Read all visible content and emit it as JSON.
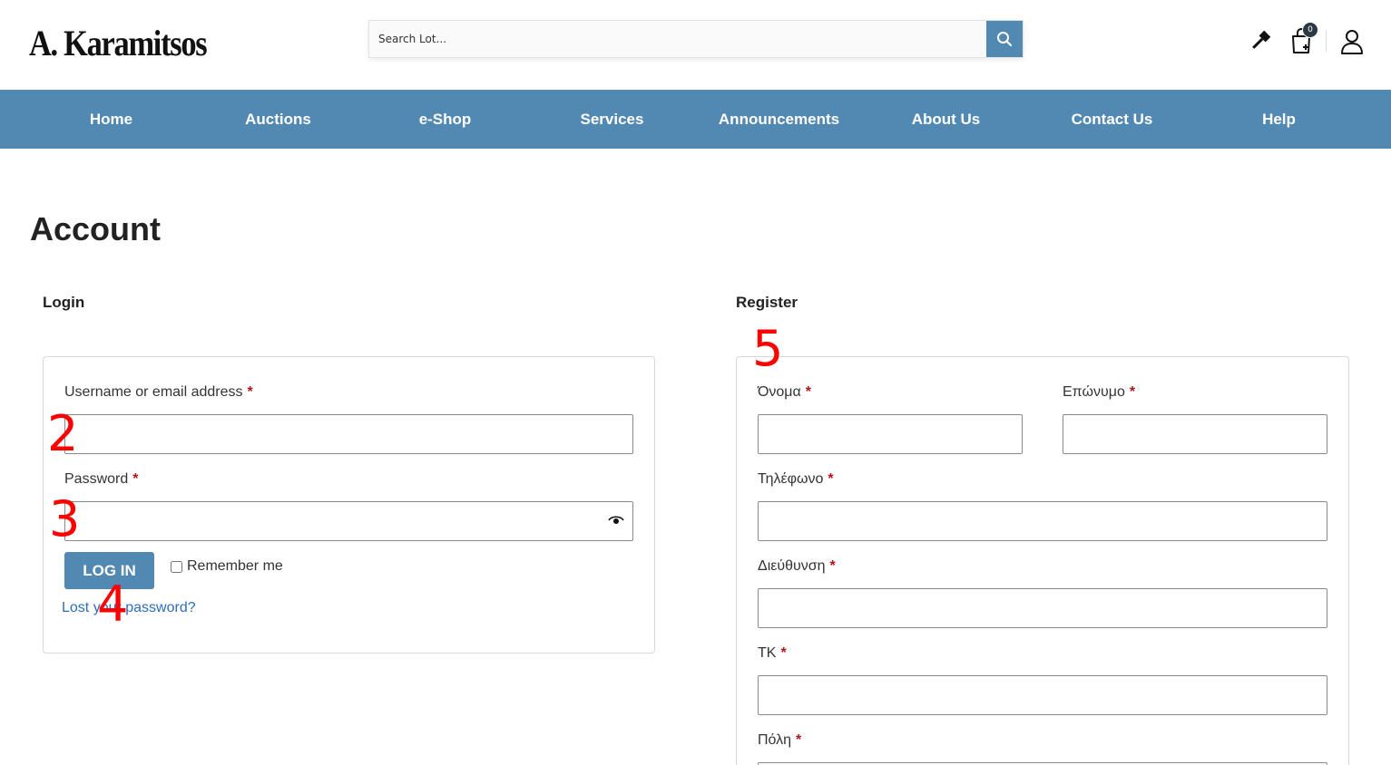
{
  "header": {
    "logo": "A. Karamitsos",
    "search_placeholder": "Search Lot...",
    "cart_count": "0"
  },
  "nav": {
    "items": [
      "Home",
      "Auctions",
      "e-Shop",
      "Services",
      "Announcements",
      "About Us",
      "Contact Us",
      "Help"
    ]
  },
  "page": {
    "title": "Account"
  },
  "login": {
    "title": "Login",
    "username_label": "Username or email address",
    "password_label": "Password",
    "required_mark": "*",
    "login_button": "LOG IN",
    "remember_label": "Remember me",
    "lost_password": "Lost your password?"
  },
  "register": {
    "title": "Register",
    "first_name_label": "Όνομα",
    "last_name_label": "Επώνυμο",
    "phone_label": "Τηλέφωνο",
    "address_label": "Διεύθυνση",
    "zip_label": "ΤΚ",
    "city_label": "Πόλη",
    "required_mark": "*"
  },
  "annotations": [
    "2",
    "3",
    "4",
    "5"
  ],
  "colors": {
    "brand": "#5289b2",
    "required": "#b0141e",
    "link": "#2e6dbc",
    "annotation": "#ff0000"
  }
}
